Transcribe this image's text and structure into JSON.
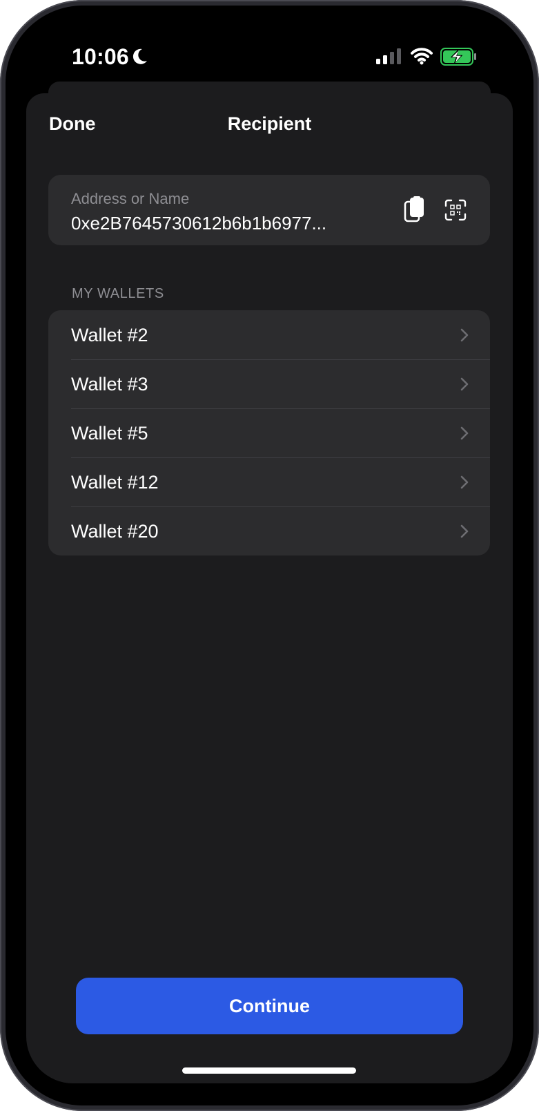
{
  "status_bar": {
    "time": "10:06",
    "icons": [
      "moon-icon",
      "signal-icon",
      "wifi-icon",
      "battery-charging-icon"
    ]
  },
  "header": {
    "done_label": "Done",
    "title": "Recipient"
  },
  "address_field": {
    "label": "Address or Name",
    "value": "0xe2B7645730612b6b1b6977...",
    "actions": [
      "paste-icon",
      "qr-scan-icon"
    ]
  },
  "wallets": {
    "section_title": "MY WALLETS",
    "items": [
      {
        "label": "Wallet #2"
      },
      {
        "label": "Wallet #3"
      },
      {
        "label": "Wallet #5"
      },
      {
        "label": "Wallet #12"
      },
      {
        "label": "Wallet #20"
      }
    ]
  },
  "footer": {
    "continue_label": "Continue"
  },
  "colors": {
    "accent": "#2c5ae4",
    "sheet_background": "#1c1c1e",
    "cell_background": "#2c2c2e",
    "secondary_text": "#8e8e93",
    "battery_charging": "#34c759"
  }
}
